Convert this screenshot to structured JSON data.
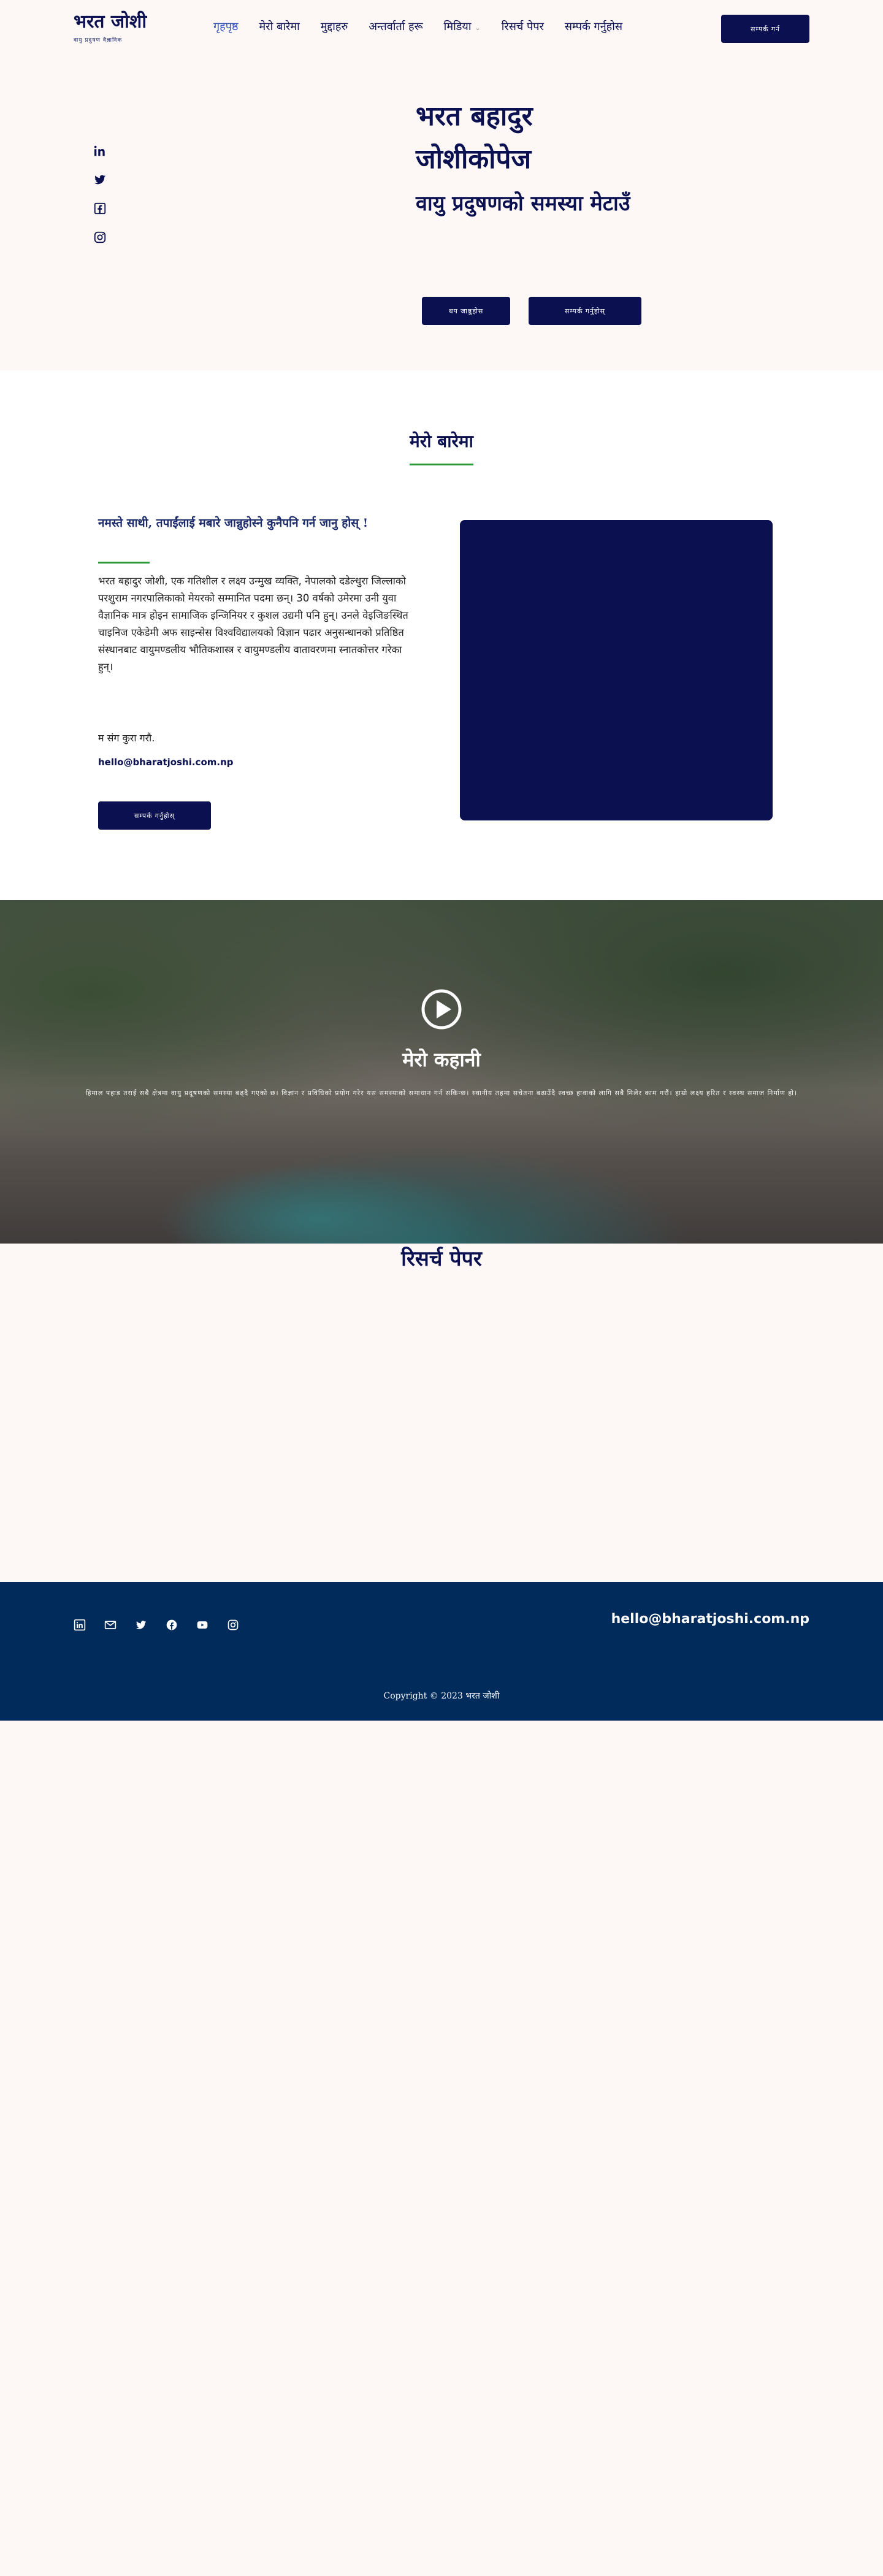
{
  "header": {
    "brand_title": "भरत जोशी",
    "brand_tagline": "वायु प्रदुषण वैज्ञानिक",
    "nav": [
      {
        "label": "गृहपृष्ठ",
        "active": true
      },
      {
        "label": "मेरो बारेमा"
      },
      {
        "label": "मुद्दाहरु"
      },
      {
        "label": "अन्तर्वार्ता हरू"
      },
      {
        "label": "मिडिया",
        "has_dropdown": true
      },
      {
        "label": "रिसर्च पेपर"
      },
      {
        "label": "सम्पर्क गर्नुहोस"
      }
    ],
    "cta_label": "सम्पर्क गर्न"
  },
  "hero": {
    "title_line1": "भरत बहादुर",
    "title_line2": "जोशीकोपेज",
    "subtitle": "वायु प्रदुषण​को समस्या मेटाउँ",
    "button1": "थप जान्नुहोस",
    "button2": "सम्पर्क गर्नुहोस्",
    "social_icons": [
      "linkedin-icon",
      "twitter-icon",
      "facebook-icon",
      "instagram-icon"
    ]
  },
  "about": {
    "section_title": "मेरो बारेमा",
    "heading": "नमस्ते साथी, तपाईंलाई म​बारे जान्नुहोस्ने कुनैपनि गर्न जानु होस् !",
    "body": "भरत बहादुर जोशी, एक गतिशील र लक्ष्य उन्मुख व्यक्ति, नेपालको दडेल्धुरा जिल्लाको परशुराम नगरपालिकाको मेयरको सम्मानित पदमा छन्। 30 वर्षको उमेरमा उनी युवा वैज्ञानिक मात्र होइन सामाजिक इन्जिनियर र कुशल उद्यमी पनि हुन्। उनले वेइजिङस्थित चाइनिज एकेडेमी अफ साइन्सेस विश्वविद्यालयको विज्ञान पढार अनुसन्धानको प्रतिष्ठित संस्थानबाट वायुमण्डलीय भौतिकशास्त्र र वायुमण्डलीय वातावरणमा स्नातकोत्तर गरेका हुन्।",
    "tail": "म संग कुरा गरौ.",
    "email": "hello@bharatjoshi.com.np",
    "button": "सम्पर्क गर्नुहोस्"
  },
  "video_band": {
    "title": "मेरो कहानी",
    "text": "हिमाल पहाड़ तराई सबै क्षेत्रमा वायु प्रदूषणको समस्या बढ्दै गएको छ। विज्ञान र प्रविधिको प्रयोग गरेर यस समस्याको समाधान गर्न सकिन्छ। स्थानीय तहमा सचेतना बढाउँदै स्वच्छ हावाको लागि सबै मिलेर काम गरौं। हाम्रो लक्ष्य हरित र स्वस्थ समाज निर्माण हो।"
  },
  "research": {
    "title": "रिसर्च पेपर"
  },
  "footer": {
    "social_icons": [
      "linkedin-icon",
      "mail-icon",
      "twitter-icon",
      "facebook-icon",
      "youtube-icon",
      "instagram-icon"
    ],
    "email": "hello@bharatjoshi.com.np",
    "copyright": "Copyright © 2023 भरत जोशी"
  }
}
